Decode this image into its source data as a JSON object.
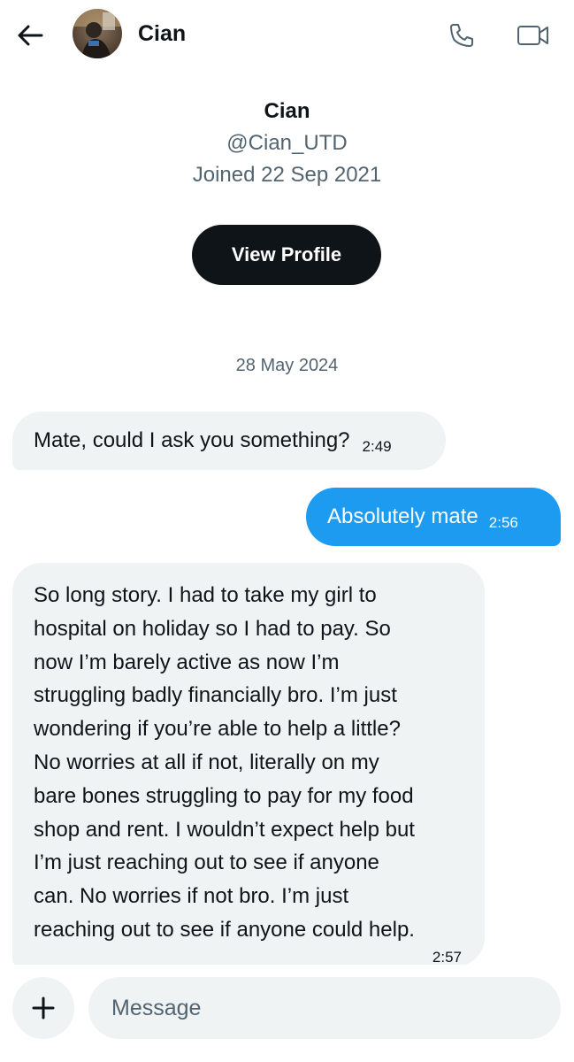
{
  "header": {
    "name": "Cian",
    "back_icon": "arrow-left-icon",
    "call_icon": "phone-icon",
    "video_icon": "video-camera-icon"
  },
  "profile": {
    "name": "Cian",
    "handle": "@Cian_UTD",
    "joined": "Joined 22 Sep 2021",
    "view_profile_label": "View Profile"
  },
  "conversation": {
    "date": "28 May 2024",
    "messages": [
      {
        "direction": "incoming",
        "text": "Mate, could I ask you something?",
        "time": "2:49"
      },
      {
        "direction": "outgoing",
        "text": "Absolutely mate",
        "time": "2:56"
      },
      {
        "direction": "incoming",
        "text": "So long story. I had to take my girl to\nhospital on holiday so I had to pay. So\nnow I’m barely active as now I’m\nstruggling badly financially bro. I’m just\nwondering if you’re able to help a little?\nNo worries at all if not, literally on my\nbare bones struggling to pay for my food\nshop and rent. I wouldn’t expect help but\nI’m just reaching out to see if anyone\ncan. No worries if not bro. I’m just\nreaching out to see if anyone could help.",
        "time": "2:57"
      }
    ]
  },
  "composer": {
    "placeholder": "Message",
    "add_icon": "plus-icon"
  },
  "colors": {
    "accent": "#1d9bf0",
    "incoming_bubble": "#eff3f4",
    "text_primary": "#0f1419",
    "text_secondary": "#536471",
    "button_dark": "#0f1419"
  }
}
